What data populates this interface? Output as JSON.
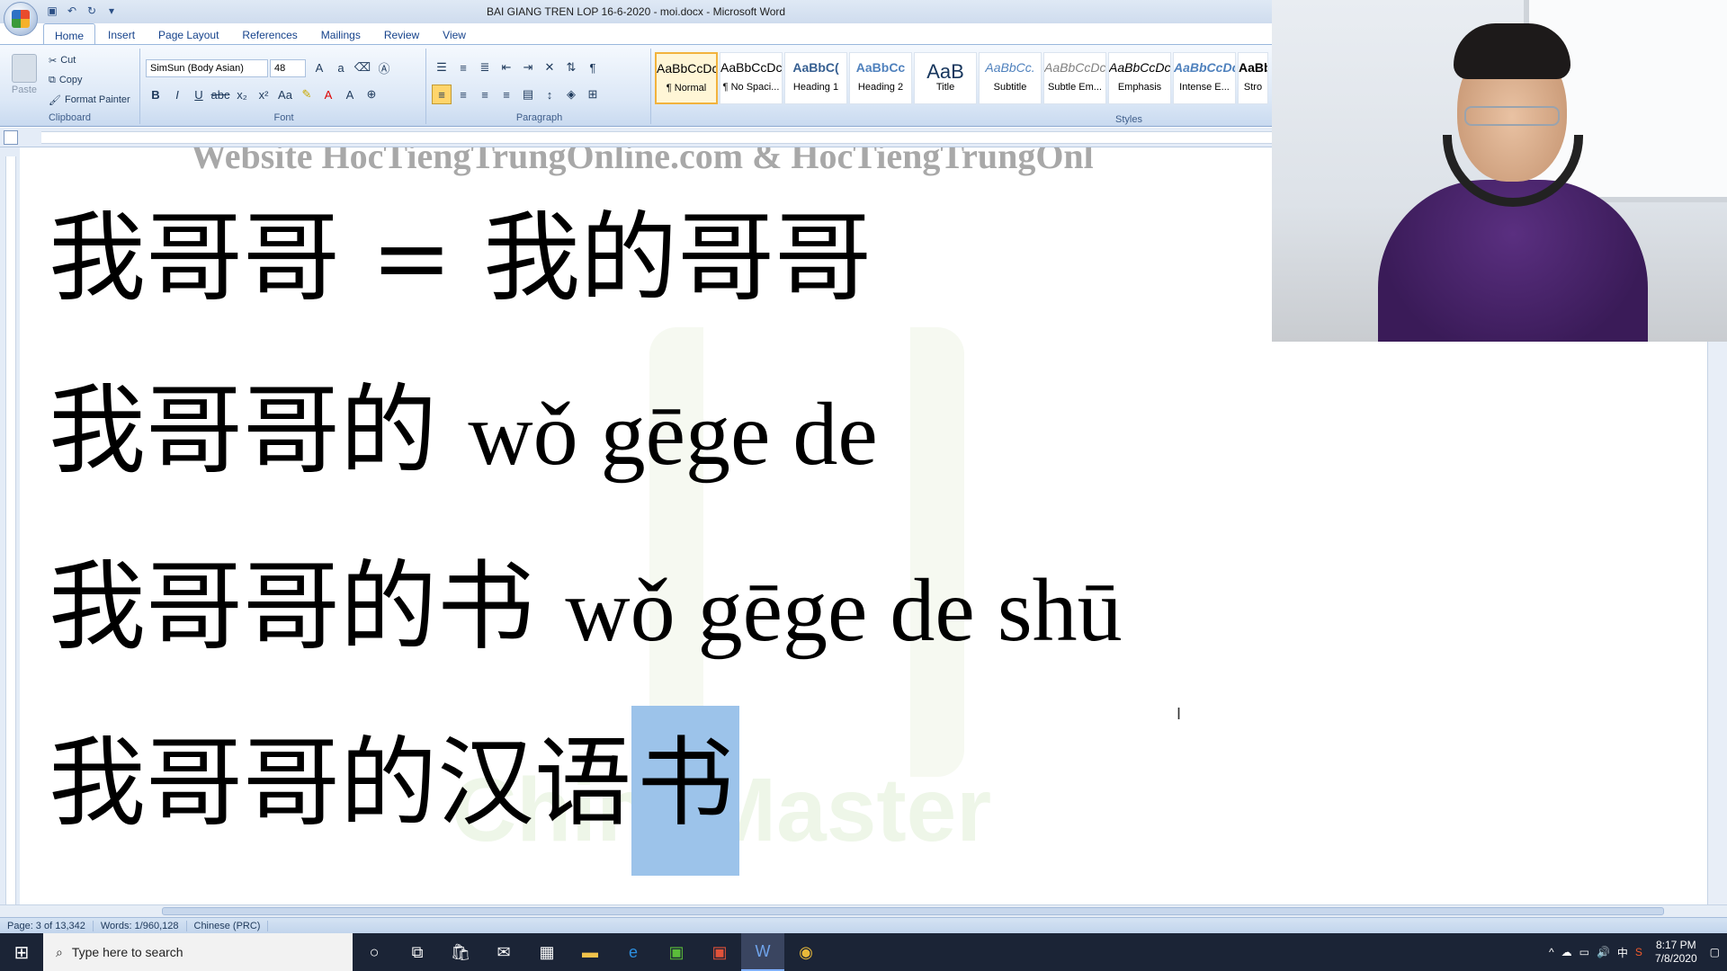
{
  "window": {
    "title": "BAI GIANG TREN LOP 16-6-2020 - moi.docx - Microsoft Word"
  },
  "tabs": [
    "Home",
    "Insert",
    "Page Layout",
    "References",
    "Mailings",
    "Review",
    "View"
  ],
  "clipboard": {
    "paste": "Paste",
    "cut": "Cut",
    "copy": "Copy",
    "format_painter": "Format Painter",
    "label": "Clipboard"
  },
  "font": {
    "name": "SimSun (Body Asian)",
    "size": "48",
    "label": "Font"
  },
  "paragraph": {
    "label": "Paragraph"
  },
  "styles": {
    "label": "Styles",
    "items": [
      {
        "preview": "AaBbCcDc",
        "name": "¶ Normal"
      },
      {
        "preview": "AaBbCcDc",
        "name": "¶ No Spaci..."
      },
      {
        "preview": "AaBbC(",
        "name": "Heading 1"
      },
      {
        "preview": "AaBbCc",
        "name": "Heading 2"
      },
      {
        "preview": "AaB",
        "name": "Title"
      },
      {
        "preview": "AaBbCc.",
        "name": "Subtitle"
      },
      {
        "preview": "AaBbCcDc",
        "name": "Subtle Em..."
      },
      {
        "preview": "AaBbCcDc",
        "name": "Emphasis"
      },
      {
        "preview": "AaBbCcDc",
        "name": "Intense E..."
      },
      {
        "preview": "AaBb",
        "name": "Stro"
      }
    ]
  },
  "document": {
    "header_text": "Website HocTiengTrungOnline.com & HocTiengTrungOnl",
    "line1": "我哥哥 = 我的哥哥",
    "line2_cn": "我哥哥的",
    "line2_py": "wǒ gēge de",
    "line3_cn": "我哥哥的书",
    "line3_py": "wǒ gēge de shū",
    "line4_cn": "我哥哥的汉语",
    "line4_sel": "书",
    "watermark": "ChineMaster"
  },
  "status": {
    "page": "Page: 3 of 13,342",
    "words": "Words: 1/960,128",
    "language": "Chinese (PRC)"
  },
  "taskbar": {
    "search_placeholder": "Type here to search",
    "time": "8:17 PM",
    "date": "7/8/2020",
    "ime": "中"
  }
}
